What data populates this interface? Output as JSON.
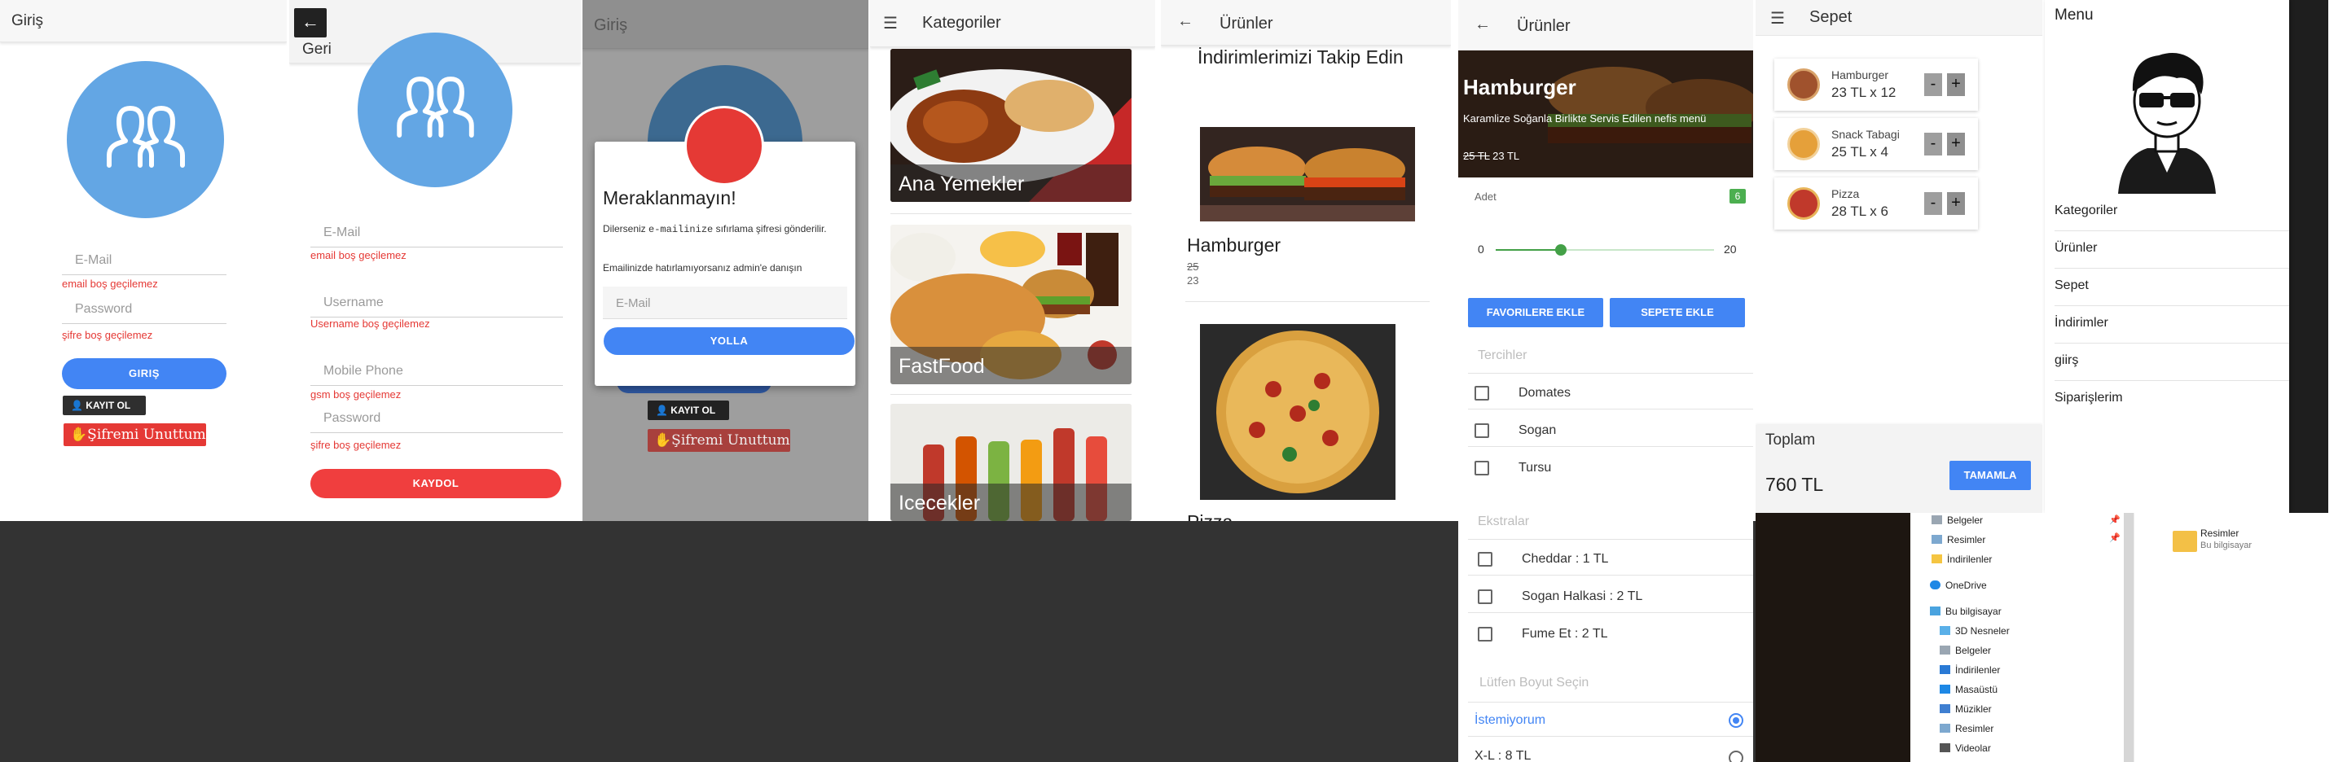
{
  "login": {
    "title": "Giriş",
    "email_placeholder": "E-Mail",
    "email_error": "email boş geçilemez",
    "password_placeholder": "Password",
    "password_error": "şifre boş geçilemez",
    "login_button": "GIRIŞ",
    "register_button": "KAYIT OL",
    "forgot_button": "Şifremi Unuttum"
  },
  "register": {
    "back_label": "Geri",
    "email_placeholder": "E-Mail",
    "email_error": "email boş geçilemez",
    "username_placeholder": "Username",
    "username_error": "Username boş geçilemez",
    "phone_placeholder": "Mobile Phone",
    "phone_error": "gsm boş geçilemez",
    "password_placeholder": "Password",
    "password_error": "şifre boş geçilemez",
    "register_button": "KAYDOL"
  },
  "reset": {
    "title": "Giriş",
    "dialog_title": "Meraklanmayın!",
    "dialog_text1_a": "Dilerseniz ",
    "dialog_text1_code": "e-mailinize",
    "dialog_text1_b": " sıfırlama şifresi gönderilir.",
    "dialog_text2": "Emailinizde hatırlamıyorsanız admin'e danışın",
    "email_placeholder": "E-Mail",
    "send_button": "YOLLA",
    "register_button": "KAYIT OL",
    "forgot_button": "Şifremi Unuttum"
  },
  "categories": {
    "title": "Kategoriler",
    "items": [
      "Ana Yemekler",
      "FastFood",
      "Icecekler"
    ]
  },
  "products": {
    "title": "Ürünler",
    "banner": "İndirimlerimizi Takip Edin",
    "item_name": "Hamburger",
    "old_price": "25",
    "new_price": "23",
    "next_item_partial": "Pizza"
  },
  "detail": {
    "title": "Ürünler",
    "product_name": "Hamburger",
    "product_desc": "Karamlize Soğanla Birlikte Servis Edilen nefis menü",
    "price_old": "25 TL",
    "price_new": "23 TL",
    "quantity_label": "Adet",
    "quantity_value": "6",
    "slider_min": "0",
    "slider_max": "20",
    "slider_value": 6,
    "fav_button": "FAVORILERE EKLE",
    "cart_button": "SEPETE EKLE",
    "prefs_title": "Tercihler",
    "prefs": [
      "Domates",
      "Sogan",
      "Tursu"
    ],
    "extras_title": "Ekstralar",
    "extras": [
      "Cheddar : 1 TL",
      "Sogan Halkasi : 2 TL",
      "Fume Et : 2 TL"
    ],
    "size_title": "Lütfen Boyut Seçin",
    "sizes": [
      "İstemiyorum",
      "X-L : 8 TL"
    ]
  },
  "cart": {
    "title": "Sepet",
    "items": [
      {
        "name": "Hamburger",
        "qty": "23 TL x 12"
      },
      {
        "name": "Snack Tabagi",
        "qty": "25 TL x 4"
      },
      {
        "name": "Pizza",
        "qty": "28 TL x 6"
      }
    ],
    "minus": "-",
    "plus": "+",
    "total_label": "Toplam",
    "total_value": "760 TL",
    "complete_button": "TAMAMLA"
  },
  "menu": {
    "title": "Menu",
    "items": [
      "Kategoriler",
      "Ürünler",
      "Sepet",
      "İndirimler",
      "giirş",
      "Siparişlerim"
    ]
  },
  "explorer": {
    "quick": [
      "Belgeler",
      "Resimler",
      "İndirilenler"
    ],
    "onedrive": "OneDrive",
    "thispc": "Bu bilgisayar",
    "pc_items": [
      "3D Nesneler",
      "Belgeler",
      "İndirilenler",
      "Masaüstü",
      "Müzikler",
      "Resimler",
      "Videolar"
    ],
    "file_name": "Resimler",
    "file_loc": "Bu bilgisayar"
  },
  "colors": {
    "accent_blue": "#4285f4",
    "error_red": "#e53935",
    "avatar_blue": "#63a6e4",
    "badge_green": "#4caf50",
    "dark_bg": "#333333"
  }
}
